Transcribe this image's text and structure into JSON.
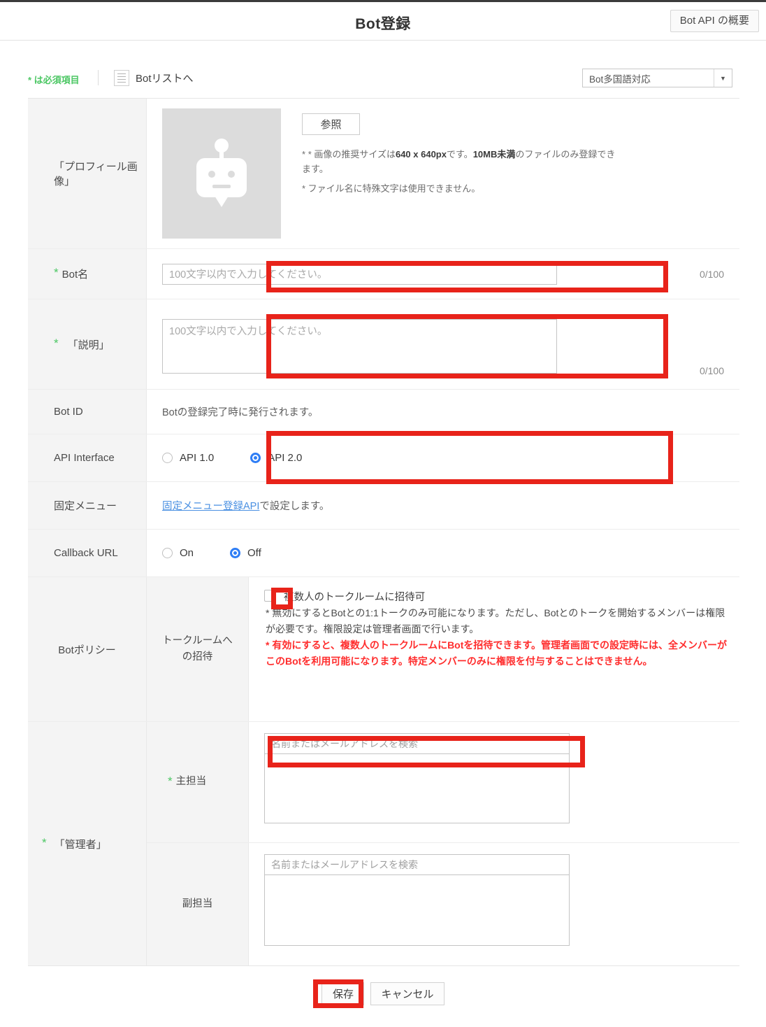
{
  "header": {
    "title": "Bot登録",
    "api_overview_button": "Bot API の概要"
  },
  "toolbar": {
    "required_note": "* は必須項目",
    "bot_list_link": "Botリストへ",
    "bot_list_icon": "list-icon",
    "language_select": {
      "value": "Bot多国語対応",
      "arrow_icon": "chevron-down-icon"
    }
  },
  "form": {
    "profile": {
      "label": "「プロフィール画像」",
      "avatar_icon": "robot-avatar-icon",
      "browse_button": "参照",
      "notes": [
        "* 画像の推奨サイズは640 x 640pxです。10MB未満のファイルのみ登録できます。",
        "* ファイル名に特殊文字は使用できません。"
      ],
      "note1_pre": "* 画像の推奨サイズは",
      "note1_bold1": "640 x 640px",
      "note1_mid": "です。",
      "note1_bold2": "10MB未満",
      "note1_post": "のファイルのみ登録できます。"
    },
    "bot_name": {
      "label": "Bot名",
      "required": true,
      "placeholder": "100文字以内で入力してください。",
      "value": "",
      "counter": "0/100"
    },
    "description": {
      "label": "「説明」",
      "required": true,
      "placeholder": "100文字以内で入力してください。",
      "value": "",
      "counter": "0/100"
    },
    "bot_id": {
      "label": "Bot ID",
      "value": "Botの登録完了時に発行されます。"
    },
    "api_interface": {
      "label": "API Interface",
      "options": [
        {
          "label": "API 1.0",
          "selected": false
        },
        {
          "label": "API 2.0",
          "selected": true
        }
      ]
    },
    "fixed_menu": {
      "label": "固定メニュー",
      "link_text": "固定メニュー登録API",
      "suffix_text": " で設定します。"
    },
    "callback_url": {
      "label": "Callback URL",
      "options": [
        {
          "label": "On",
          "selected": false
        },
        {
          "label": "Off",
          "selected": true
        }
      ]
    },
    "bot_policy": {
      "label": "Botポリシー",
      "sub_label": "トークルームへ\nの招待",
      "sub_label_line1": "トークルームへ",
      "sub_label_line2": "の招待",
      "checkbox_label": "複数人のトークルームに招待可",
      "checkbox_checked": false,
      "description": "* 無効にするとBotとの1:1トークのみ可能になります。ただし、Botとのトークを開始するメンバーは権限が必要です。権限設定は管理者画面で行います。",
      "warning": "* 有効にすると、複数人のトークルームにBotを招待できます。管理者画面での設定時には、全メンバーがこのBotを利用可能になります。特定メンバーのみに権限を付与することはできません。",
      "warning_color": "#ff2d2d"
    },
    "administrators": {
      "label": "「管理者」",
      "required": true,
      "primary": {
        "label": "主担当",
        "required": true,
        "search_placeholder": "名前またはメールアドレスを検索",
        "search_value": "",
        "selected_items": []
      },
      "secondary": {
        "label": "副担当",
        "required": false,
        "search_placeholder": "名前またはメールアドレスを検索",
        "search_value": "",
        "selected_items": []
      }
    }
  },
  "footer": {
    "save_button": "保存",
    "cancel_button": "キャンセル"
  },
  "colors": {
    "accent_green": "#4CC764",
    "annotation_red": "#e8231a",
    "link_blue": "#4a90e2",
    "radio_blue": "#2f7ef5",
    "warning_red": "#ff2d2d"
  }
}
